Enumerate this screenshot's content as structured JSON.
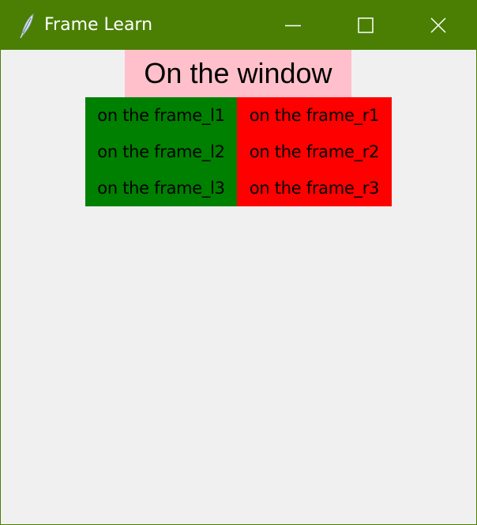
{
  "window": {
    "title": "Frame Learn",
    "app_icon": "feather-icon",
    "controls": {
      "minimize": "minimize-icon",
      "maximize": "maximize-icon",
      "close": "close-icon"
    },
    "colors": {
      "titlebar": "#4a7f04",
      "title_text": "#ffffff",
      "background": "#f0f0f0"
    }
  },
  "content": {
    "window_label": {
      "text": "On the window",
      "bg": "#ffc0cb"
    },
    "left_frame": {
      "bg": "#008000",
      "labels": [
        "on the frame_l1",
        "on the frame_l2",
        "on the frame_l3"
      ]
    },
    "right_frame": {
      "bg": "#ff0000",
      "labels": [
        "on the frame_r1",
        "on the frame_r2",
        "on the frame_r3"
      ]
    }
  }
}
